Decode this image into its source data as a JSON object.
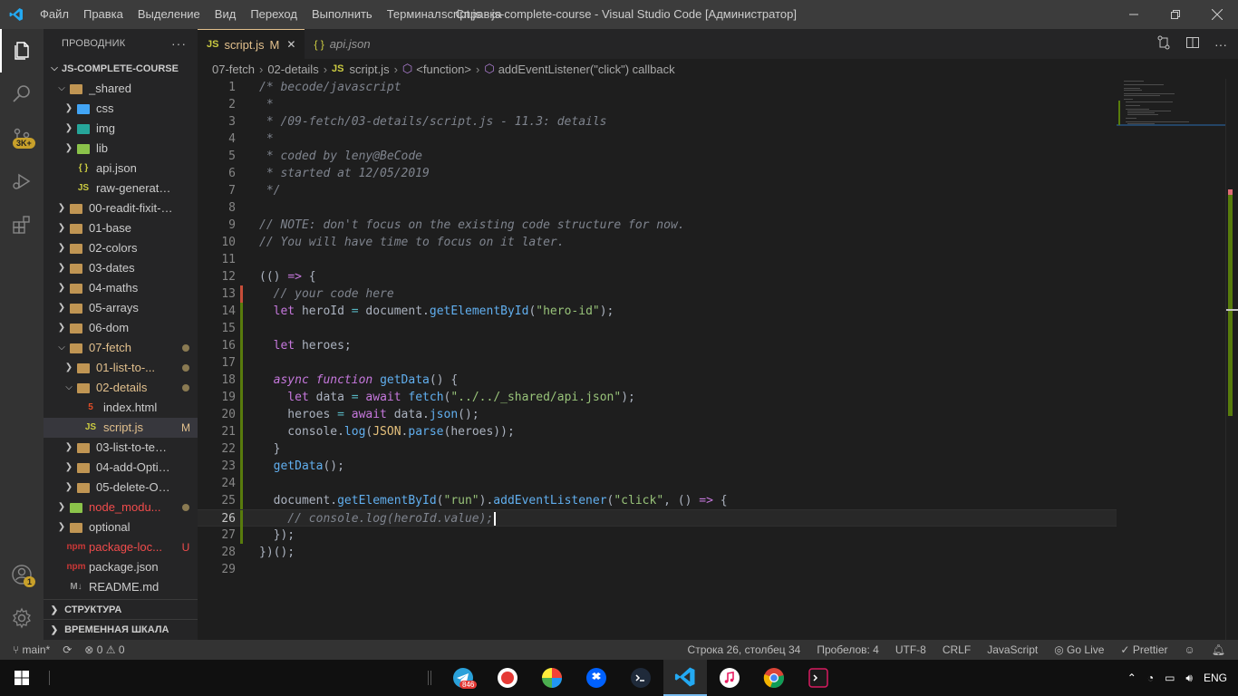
{
  "window": {
    "title": "script.js - js-complete-course - Visual Studio Code [Администратор]",
    "menu": [
      "Файл",
      "Правка",
      "Выделение",
      "Вид",
      "Переход",
      "Выполнить",
      "Терминал",
      "Справка"
    ]
  },
  "activitybar": {
    "scm_badge": "3K+",
    "accounts_badge": "1"
  },
  "sidebar": {
    "header": "ПРОВОДНИК",
    "more": "···",
    "root": "JS-COMPLETE-COURSE",
    "items": [
      {
        "label": "_shared",
        "kind": "folder-open",
        "icon": "folder-icon",
        "depth": 1,
        "expanded": true,
        "deco": ""
      },
      {
        "label": "css",
        "kind": "folder",
        "icon": "css-folder-icon",
        "depth": 2,
        "expanded": false,
        "deco": ""
      },
      {
        "label": "img",
        "kind": "folder",
        "icon": "image-folder-icon",
        "depth": 2,
        "expanded": false,
        "deco": ""
      },
      {
        "label": "lib",
        "kind": "folder",
        "icon": "lib-folder-icon",
        "depth": 2,
        "expanded": false,
        "deco": ""
      },
      {
        "label": "api.json",
        "kind": "file",
        "icon": "json-file-icon",
        "depth": 2,
        "deco": ""
      },
      {
        "label": "raw-generator.js",
        "kind": "file",
        "icon": "js-file-icon",
        "depth": 2,
        "deco": ""
      },
      {
        "label": "00-readit-fixit-wri...",
        "kind": "folder",
        "icon": "folder-icon",
        "depth": 1,
        "deco": ""
      },
      {
        "label": "01-base",
        "kind": "folder",
        "icon": "folder-icon",
        "depth": 1,
        "deco": ""
      },
      {
        "label": "02-colors",
        "kind": "folder",
        "icon": "folder-icon",
        "depth": 1,
        "deco": ""
      },
      {
        "label": "03-dates",
        "kind": "folder",
        "icon": "folder-icon",
        "depth": 1,
        "deco": ""
      },
      {
        "label": "04-maths",
        "kind": "folder",
        "icon": "folder-icon",
        "depth": 1,
        "deco": ""
      },
      {
        "label": "05-arrays",
        "kind": "folder",
        "icon": "folder-icon",
        "depth": 1,
        "deco": ""
      },
      {
        "label": "06-dom",
        "kind": "folder",
        "icon": "folder-icon",
        "depth": 1,
        "deco": ""
      },
      {
        "label": "07-fetch",
        "kind": "folder-open",
        "icon": "folder-icon",
        "depth": 1,
        "deco": "dot",
        "modified": true
      },
      {
        "label": "01-list-to-...",
        "kind": "folder",
        "icon": "folder-icon",
        "depth": 2,
        "deco": "dot",
        "modified": true
      },
      {
        "label": "02-details",
        "kind": "folder-open",
        "icon": "folder-icon",
        "depth": 2,
        "deco": "dot",
        "modified": true
      },
      {
        "label": "index.html",
        "kind": "file",
        "icon": "html-file-icon",
        "depth": 3,
        "deco": ""
      },
      {
        "label": "script.js",
        "kind": "file",
        "icon": "js-file-icon",
        "depth": 3,
        "deco": "M",
        "modified": true,
        "selected": true
      },
      {
        "label": "03-list-to-templ...",
        "kind": "folder",
        "icon": "folder-icon",
        "depth": 2,
        "deco": ""
      },
      {
        "label": "04-add-Optional",
        "kind": "folder",
        "icon": "folder-icon",
        "depth": 2,
        "deco": ""
      },
      {
        "label": "05-delete-Optio...",
        "kind": "folder",
        "icon": "folder-icon",
        "depth": 2,
        "deco": ""
      },
      {
        "label": "node_modu...",
        "kind": "folder",
        "icon": "node-folder-icon",
        "depth": 1,
        "deco": "dot",
        "danger": true
      },
      {
        "label": "optional",
        "kind": "folder",
        "icon": "folder-icon",
        "depth": 1,
        "deco": ""
      },
      {
        "label": "package-loc...",
        "kind": "file",
        "icon": "npm-file-icon",
        "depth": 1,
        "deco": "U",
        "danger": true
      },
      {
        "label": "package.json",
        "kind": "file",
        "icon": "npm-file-icon",
        "depth": 1,
        "deco": ""
      },
      {
        "label": "README.md",
        "kind": "file",
        "icon": "markdown-file-icon",
        "depth": 1,
        "deco": ""
      }
    ],
    "outline": "СТРУКТУРА",
    "timeline": "ВРЕМЕННАЯ ШКАЛА"
  },
  "tabs": [
    {
      "label": "script.js",
      "badge": "M",
      "close": "✕",
      "active": true,
      "icon": "JS"
    },
    {
      "label": "api.json",
      "active": false,
      "icon": "{ }"
    }
  ],
  "breadcrumb": [
    "07-fetch",
    "02-details",
    "script.js",
    "<function>",
    "addEventListener(\"click\") callback"
  ],
  "editor": {
    "current_line": 26,
    "lines": [
      [
        [
          "c-cm",
          "/* becode/javascript"
        ]
      ],
      [
        [
          "c-cm",
          " *"
        ]
      ],
      [
        [
          "c-cm",
          " * /09-fetch/03-details/script.js - 11.3: details"
        ]
      ],
      [
        [
          "c-cm",
          " *"
        ]
      ],
      [
        [
          "c-cm",
          " * coded by leny@BeCode"
        ]
      ],
      [
        [
          "c-cm",
          " * started at 12/05/2019"
        ]
      ],
      [
        [
          "c-cm",
          " */"
        ]
      ],
      [],
      [
        [
          "c-cm",
          "// NOTE: don't focus on the existing code structure for now."
        ]
      ],
      [
        [
          "c-cm",
          "// You will have time to focus on it later."
        ]
      ],
      [],
      [
        [
          "c-txt",
          "(() "
        ],
        [
          "c-kw",
          "=>"
        ],
        [
          "c-txt",
          " {"
        ]
      ],
      [
        [
          "c-cm",
          "  // your code here"
        ]
      ],
      [
        [
          "c-kw",
          "  let "
        ],
        [
          "c-txt",
          "heroId "
        ],
        [
          "c-op",
          "="
        ],
        [
          "c-txt",
          " document."
        ],
        [
          "c-fn",
          "getElementById"
        ],
        [
          "c-txt",
          "("
        ],
        [
          "c-str",
          "\"hero-id\""
        ],
        [
          "c-txt",
          ");"
        ]
      ],
      [],
      [
        [
          "c-kw",
          "  let "
        ],
        [
          "c-txt",
          "heroes;"
        ]
      ],
      [],
      [
        [
          "c-kw-i",
          "  async "
        ],
        [
          "c-kw-i",
          "function "
        ],
        [
          "c-fn",
          "getData"
        ],
        [
          "c-txt",
          "() {"
        ]
      ],
      [
        [
          "c-kw",
          "    let "
        ],
        [
          "c-txt",
          "data "
        ],
        [
          "c-op",
          "="
        ],
        [
          "c-kw",
          " await "
        ],
        [
          "c-fn",
          "fetch"
        ],
        [
          "c-txt",
          "("
        ],
        [
          "c-str",
          "\"../../_shared/api.json\""
        ],
        [
          "c-txt",
          ");"
        ]
      ],
      [
        [
          "c-txt",
          "    heroes "
        ],
        [
          "c-op",
          "="
        ],
        [
          "c-kw",
          " await "
        ],
        [
          "c-txt",
          "data."
        ],
        [
          "c-fn",
          "json"
        ],
        [
          "c-txt",
          "();"
        ]
      ],
      [
        [
          "c-txt",
          "    console."
        ],
        [
          "c-fn",
          "log"
        ],
        [
          "c-txt",
          "("
        ],
        [
          "c-obj",
          "JSON"
        ],
        [
          "c-txt",
          "."
        ],
        [
          "c-fn",
          "parse"
        ],
        [
          "c-txt",
          "(heroes));"
        ]
      ],
      [
        [
          "c-txt",
          "  }"
        ]
      ],
      [
        [
          "c-txt",
          "  "
        ],
        [
          "c-fn",
          "getData"
        ],
        [
          "c-txt",
          "();"
        ]
      ],
      [],
      [
        [
          "c-txt",
          "  document."
        ],
        [
          "c-fn",
          "getElementById"
        ],
        [
          "c-txt",
          "("
        ],
        [
          "c-str",
          "\"run\""
        ],
        [
          "c-txt",
          ")."
        ],
        [
          "c-fn",
          "addEventListener"
        ],
        [
          "c-txt",
          "("
        ],
        [
          "c-str",
          "\"click\""
        ],
        [
          "c-txt",
          ", () "
        ],
        [
          "c-kw",
          "=>"
        ],
        [
          "c-txt",
          " {"
        ]
      ],
      [
        [
          "c-cm",
          "    // console.log(heroId.value);"
        ]
      ],
      [
        [
          "c-txt",
          "  });"
        ]
      ],
      [
        [
          "c-txt",
          "})();"
        ]
      ],
      []
    ],
    "gutter_added_from": 14,
    "gutter_added_to": 27,
    "gutter_modified_line": 13
  },
  "statusbar": {
    "branch": "main*",
    "errors": "0",
    "warnings": "0",
    "position": "Строка 26, столбец 34",
    "spaces": "Пробелов: 4",
    "encoding": "UTF-8",
    "eol": "CRLF",
    "language": "JavaScript",
    "golive": "Go Live",
    "prettier": "Prettier"
  },
  "taskbar": {
    "telegram_badge": "846",
    "lang": "ENG"
  },
  "colors": {
    "modified": "#e2c08d",
    "danger": "#f14c4c",
    "accent": "#0078d4"
  }
}
